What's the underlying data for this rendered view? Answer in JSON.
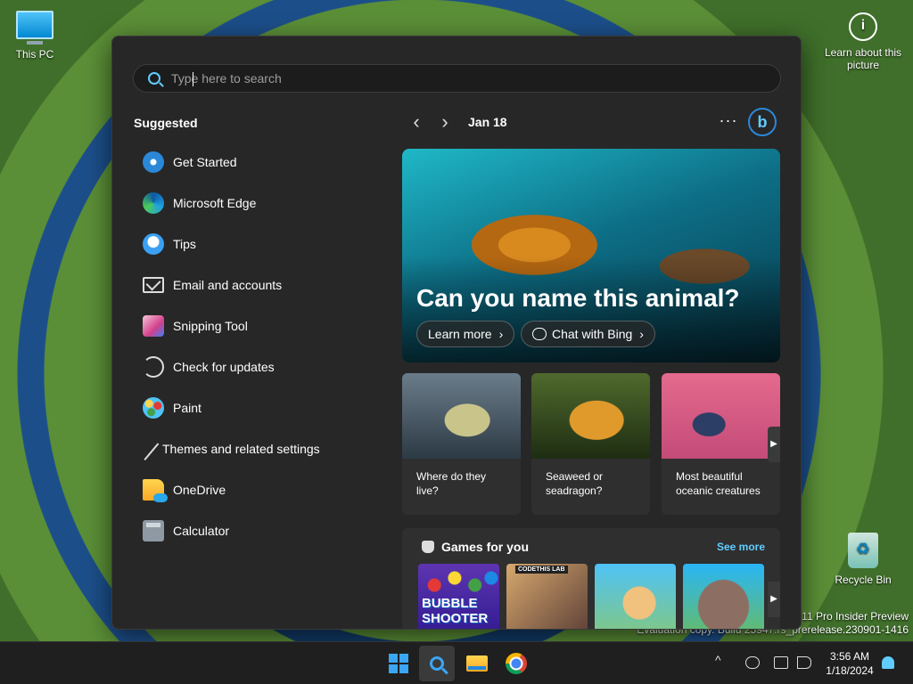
{
  "desktop": {
    "this_pc": "This PC",
    "learn_about": "Learn about this picture",
    "recycle_bin": "Recycle Bin",
    "watermark_line1": "11 Pro Insider Preview",
    "watermark_line2": "Evaluation copy. Build 25947.rs_prerelease.230901-1416"
  },
  "search": {
    "placeholder": "Type here to search"
  },
  "suggested": {
    "title": "Suggested",
    "items": [
      {
        "label": "Get Started",
        "icon": "get-started-icon"
      },
      {
        "label": "Microsoft Edge",
        "icon": "edge-icon"
      },
      {
        "label": "Tips",
        "icon": "tips-icon"
      },
      {
        "label": "Email and accounts",
        "icon": "mail-icon"
      },
      {
        "label": "Snipping Tool",
        "icon": "snipping-tool-icon"
      },
      {
        "label": "Check for updates",
        "icon": "refresh-icon"
      },
      {
        "label": "Paint",
        "icon": "paint-icon"
      },
      {
        "label": "Themes and related settings",
        "icon": "brush-icon"
      },
      {
        "label": "OneDrive",
        "icon": "onedrive-icon"
      },
      {
        "label": "Calculator",
        "icon": "calculator-icon"
      }
    ]
  },
  "highlights": {
    "date": "Jan 18",
    "prev": "‹",
    "next": "›",
    "more": "···",
    "bing": "b",
    "hero": {
      "title": "Can you name this animal?",
      "learn_more": "Learn more",
      "chat_with_bing": "Chat with Bing"
    },
    "cards": [
      {
        "text": "Where do they live?"
      },
      {
        "text": "Seaweed or seadragon?"
      },
      {
        "text": "Most beautiful oceanic creatures"
      }
    ],
    "games": {
      "title": "Games for you",
      "see_more": "See more",
      "tile1": "BUBBLE SHOOTER",
      "tile2": "CODETHIS LAB"
    }
  },
  "taskbar": {
    "time": "3:56 AM",
    "date": "1/18/2024",
    "chevron": "^"
  },
  "colors": {
    "accent": "#60cdff",
    "panel": "#272727",
    "taskbar": "#1f1f1f"
  }
}
